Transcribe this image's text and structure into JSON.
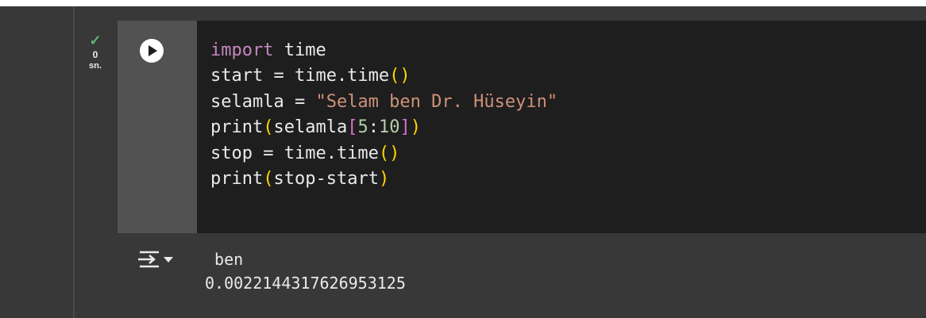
{
  "cell": {
    "status": {
      "check_glyph": "✓",
      "exec_time_value": "0",
      "exec_time_unit": "sn.",
      "check_color": "#5bb974"
    },
    "run_button": {
      "icon": "play-icon"
    },
    "code": {
      "line1": {
        "kw": "import",
        "rest": " time"
      },
      "line2": {
        "a": "start = time.time",
        "open": "(",
        "close": ")"
      },
      "line3": {
        "a": "selamla = ",
        "str": "\"Selam ben Dr. Hüseyin\""
      },
      "line4": {
        "a": "print",
        "open": "(",
        "b": "selamla",
        "open2": "[",
        "n1": "5",
        "colon": ":",
        "n2": "10",
        "close2": "]",
        "close": ")"
      },
      "line5": {
        "a": "stop = time.time",
        "open": "(",
        "close": ")"
      },
      "line6": {
        "a": "print",
        "open": "(",
        "b": "stop-start",
        "close": ")"
      }
    },
    "output": {
      "icon": "output-options-icon",
      "line1": " ben",
      "line2": "0.0022144317626953125"
    }
  },
  "colors": {
    "editor_bg": "#1e1e1e",
    "keyword": "#c586c0",
    "string": "#ce9178",
    "number": "#b5cea8",
    "bracket_1": "#ffd700",
    "bracket_2": "#da70d6"
  }
}
